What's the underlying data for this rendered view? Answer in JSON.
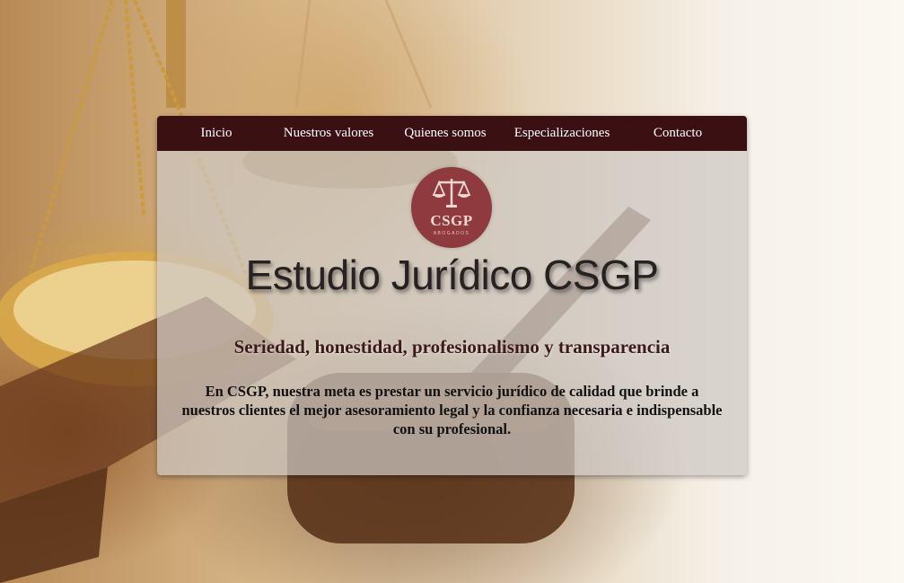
{
  "nav": {
    "items": [
      {
        "label": "Inicio"
      },
      {
        "label": "Nuestros valores"
      },
      {
        "label": "Quienes somos"
      },
      {
        "label": "Especializaciones"
      },
      {
        "label": "Contacto"
      }
    ]
  },
  "logo": {
    "icon": "scales-of-justice-icon",
    "text": "CSGP",
    "subtext": "ABOGADOS"
  },
  "hero": {
    "title": "Estudio Jurídico CSGP",
    "tagline": "Seriedad, honestidad, profesionalismo y transparencia",
    "description": "En CSGP, nuestra meta es prestar un servicio jurídico de calidad que brinde a nuestros clientes el mejor asesoramiento legal y la confianza necesaria e indispensable con su profesional."
  },
  "colors": {
    "nav_background": "#3b1012",
    "logo_background": "#8e3a3e"
  }
}
